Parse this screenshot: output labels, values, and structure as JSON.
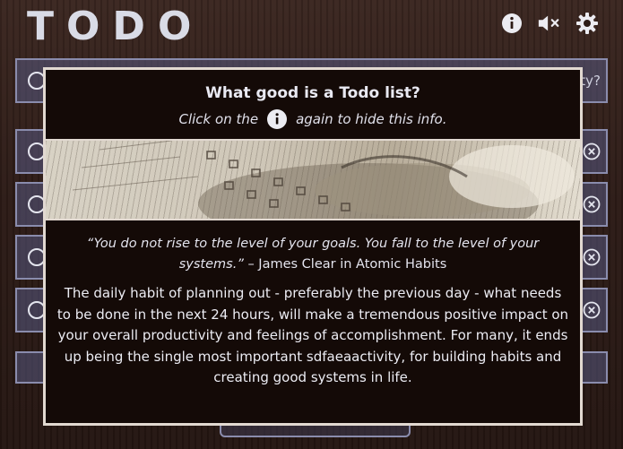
{
  "header": {
    "title": "TODO",
    "icons": [
      "info-icon",
      "mute-icon",
      "settings-gear-icon"
    ]
  },
  "background_rows": {
    "partial_text": "ty?",
    "count": 5
  },
  "modal": {
    "title": "What good is a Todo list?",
    "subtitle_before": "Click on the",
    "subtitle_after": "again to hide this info.",
    "quote_text": "“You do not rise to the level of your goals. You fall to the level of your systems.”",
    "quote_attribution": " – James Clear in Atomic Habits",
    "body": "The daily habit of planning out - preferably the previous day - what needs to be done in the next 24 hours, will make a tremendous positive impact on your overall productivity and feelings of accomplishment. For many, it ends up being the single most important sdfaeaactivity, for building habits and creating good systems in life."
  },
  "colors": {
    "background": "#2c1b16",
    "modal_bg": "#140a07",
    "modal_border": "#e2d9d1",
    "row_border": "#8a8cad"
  }
}
